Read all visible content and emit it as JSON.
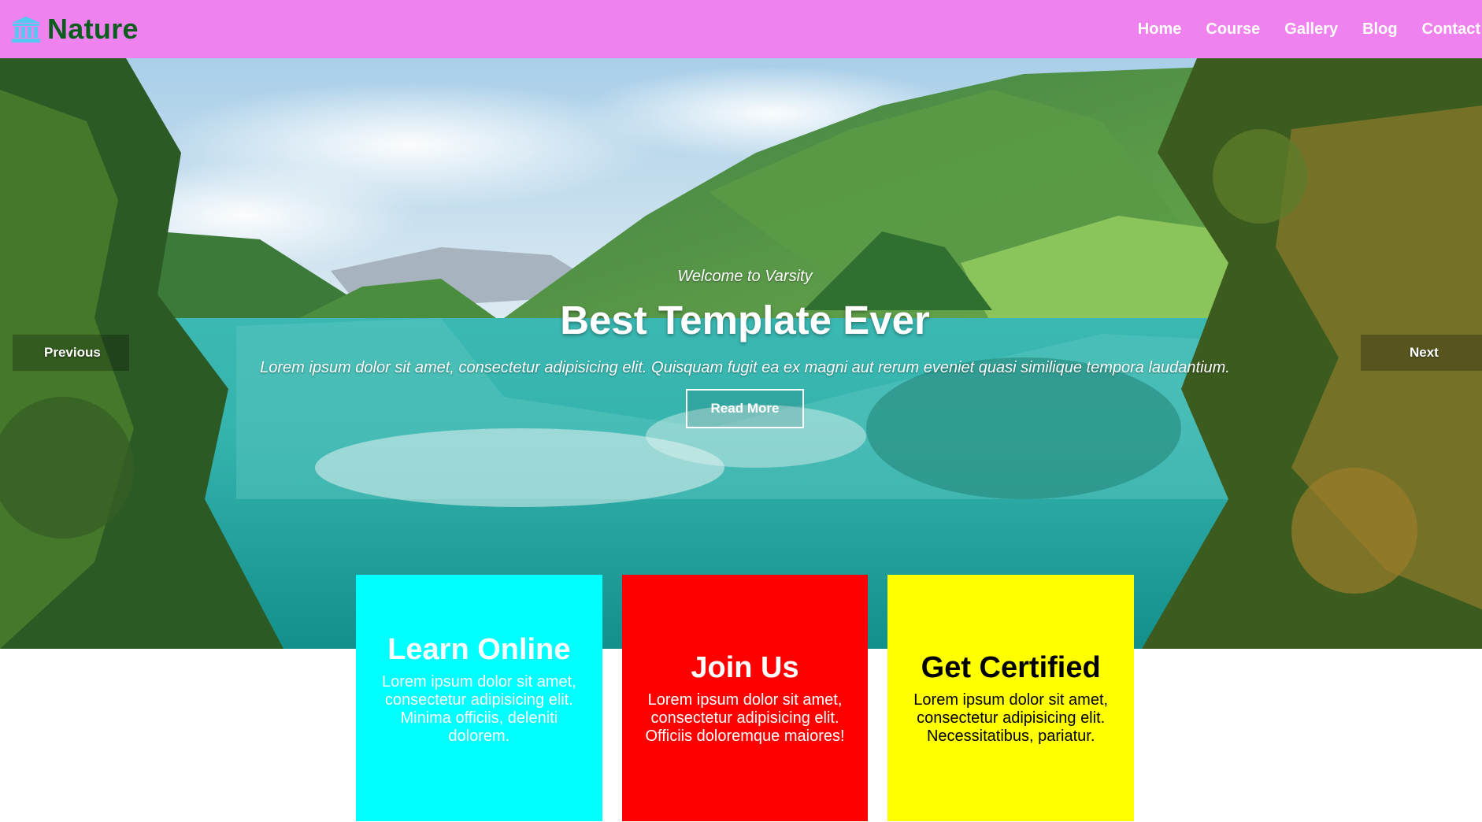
{
  "header": {
    "brand_icon": "university-icon",
    "brand_name": "Nature",
    "nav": [
      "Home",
      "Course",
      "Gallery",
      "Blog",
      "Contact"
    ]
  },
  "hero": {
    "tagline": "Welcome to Varsity",
    "headline": "Best Template Ever",
    "lead": "Lorem ipsum dolor sit amet, consectetur adipisicing elit. Quisquam fugit ea ex magni aut rerum eveniet quasi similique tempora laudantium.",
    "cta_label": "Read More",
    "prev_label": "Previous",
    "next_label": "Next"
  },
  "features": [
    {
      "title": "Learn Online",
      "text": "Lorem ipsum dolor sit amet, consectetur adipisicing elit. Minima officiis, deleniti dolorem.",
      "color": "#00ffff"
    },
    {
      "title": "Join Us",
      "text": "Lorem ipsum dolor sit amet, consectetur adipisicing elit. Officiis doloremque maiores!",
      "color": "#ff0000"
    },
    {
      "title": "Get Certified",
      "text": "Lorem ipsum dolor sit amet, consectetur adipisicing elit. Necessitatibus, pariatur.",
      "color": "#ffff00"
    }
  ],
  "colors": {
    "navbar": "#ef82ef",
    "brand_text": "#0b5d1e",
    "brand_icon": "#55c8f0"
  }
}
